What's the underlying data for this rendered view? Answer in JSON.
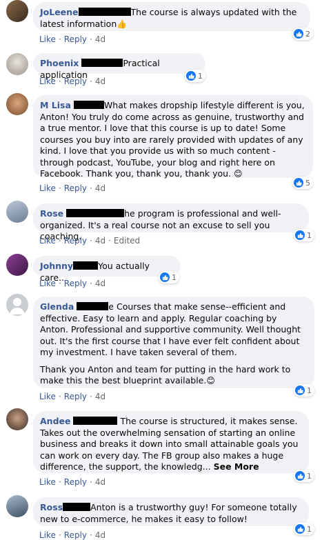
{
  "comments": [
    {
      "name": "JoLeene",
      "text": "The course is always updated with the latest information",
      "emoji": "👍",
      "actions": {
        "like": "Like",
        "reply": "Reply",
        "time": "4d"
      },
      "reactions": "2"
    },
    {
      "name": "Phoenix",
      "text": "Practical application",
      "actions": {
        "like": "Like",
        "reply": "Reply",
        "time": "4d"
      },
      "reactions": "1"
    },
    {
      "name": "M Lisa",
      "text": "What makes dropship lifestyle different is you, Anton! You truly do come across as genuine, trustworthy and a true mentor. I love that this course is up to date! Some courses you buy into are rarely provided with updates of any kind. I love that you provide us with so much content - through podcast, YouTube, your blog and right here on Facebook. Thank you, thank you, thank you.",
      "emoji": "😊",
      "actions": {
        "like": "Like",
        "reply": "Reply",
        "time": "4d"
      },
      "reactions": "5"
    },
    {
      "name": "Rose",
      "text": "he program is professional and well-organized. It's a real course not an excuse to sell you coaching.",
      "actions": {
        "like": "Like",
        "reply": "Reply",
        "time": "4d",
        "edited": "Edited"
      },
      "reactions": "1"
    },
    {
      "name": "Johnny",
      "text": "You actually care..",
      "actions": {
        "like": "Like",
        "reply": "Reply",
        "time": "4d"
      },
      "reactions": "1"
    },
    {
      "name": "Glenda",
      "text": "e Courses that make sense--efficient and effective. Easy to learn and apply. Regular coaching by Anton. Professional and supportive community. Well thought out. It's the first course that I have ever felt confident about my investment. I have taken several of them.",
      "text2": "Thank you Anton and team for putting in the hard work to make this the best blueprint available.",
      "emoji": "😊",
      "actions": {
        "like": "Like",
        "reply": "Reply",
        "time": "4d"
      },
      "reactions": "1"
    },
    {
      "name": "Andee",
      "text": "The course is structured, it makes sense. Takes out the overwhelming sensation of starting an online business and breaks it down into small attainable goals you can work on every day. The FB group also makes a huge difference, the support, the knowledg...",
      "see_more": "See More",
      "actions": {
        "like": "Like",
        "reply": "Reply",
        "time": "4d"
      },
      "reactions": "1"
    },
    {
      "name": "Ross",
      "text": "Anton is a trustworthy guy! For someone totally new to e-commerce, he makes it easy to follow!",
      "actions": {
        "like": "Like",
        "reply": "Reply",
        "time": "4d"
      },
      "reactions": "1"
    }
  ],
  "colors": {
    "name": "#385898",
    "bubble": "#f0f2f5",
    "like_blue": "#1877f2",
    "muted": "#65676b"
  },
  "icons": {
    "reaction": "thumbs-up-icon"
  }
}
